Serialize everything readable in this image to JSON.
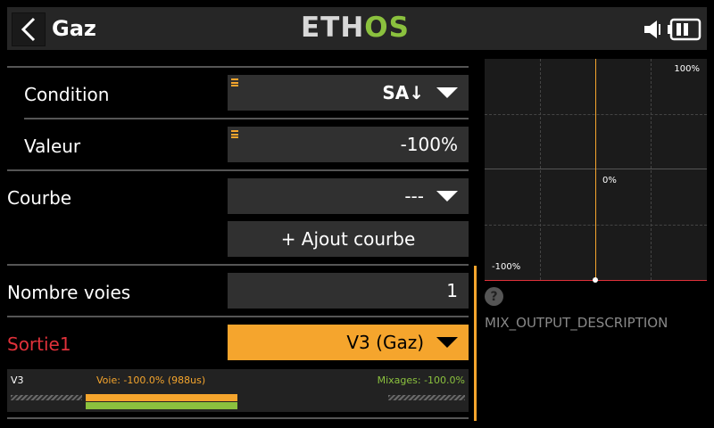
{
  "header": {
    "title": "Gaz",
    "logo_left": "ETH",
    "logo_right": "OS"
  },
  "form": {
    "condition": {
      "label": "Condition",
      "value": "SA↓"
    },
    "valeur": {
      "label": "Valeur",
      "value": "-100%"
    },
    "courbe": {
      "label": "Courbe",
      "value": "---"
    },
    "add_curve_label": "+ Ajout courbe",
    "nombre_voies": {
      "label": "Nombre voies",
      "value": "1"
    },
    "sortie": {
      "label": "Sortie1",
      "value": "V3 (Gaz)"
    }
  },
  "monitor": {
    "channel": "V3",
    "voie": "Voie: -100.0% (988us)",
    "mixages": "Mixages: -100.0%",
    "voie_percent": -100,
    "mix_percent": -100
  },
  "graph": {
    "top_right": "100%",
    "center": "0%",
    "bottom_left": "-100%"
  },
  "help": {
    "icon_char": "?",
    "description": "MIX_OUTPUT_DESCRIPTION"
  },
  "colors": {
    "accent": "#f5a52d",
    "mix_green": "#8bc13e",
    "error_red": "#e0313a"
  }
}
